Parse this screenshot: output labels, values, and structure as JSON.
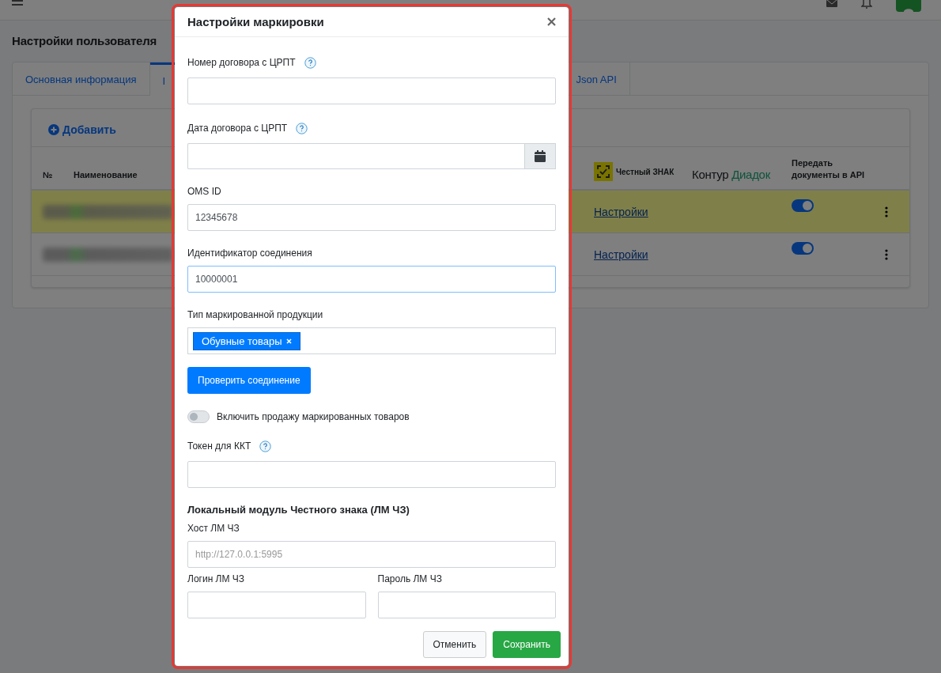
{
  "page": {
    "title": "Настройки пользователя",
    "tabs": [
      {
        "label": "Основная информация",
        "selected": false
      },
      {
        "label": "I",
        "selected": true
      },
      {
        "label": "Json API",
        "selected": false
      }
    ],
    "add_button": "Добавить",
    "table": {
      "columns": {
        "number": "№",
        "name": "Наименование",
        "chz": "Честный ЗНАК",
        "diadok_brand": "Контур",
        "diadok_product": "Диадок",
        "api": "Передать документы в API"
      },
      "rows": [
        {
          "highlighted": true,
          "settings_link": "Настройки",
          "api_on": true
        },
        {
          "highlighted": false,
          "settings_link": "Настройки",
          "api_on": true
        }
      ]
    }
  },
  "modal": {
    "title": "Настройки маркировки",
    "items": [
      {
        "kind": "text",
        "label": "Номер договора с ЦРПТ",
        "help": true
      },
      {
        "kind": "date",
        "label": "Дата договора с ЦРПТ",
        "help": true
      },
      {
        "kind": "text",
        "label": "OMS ID",
        "value": "12345678"
      },
      {
        "kind": "text",
        "label": "Идентификатор соединения",
        "value": "10000001",
        "focused": true
      },
      {
        "kind": "tags",
        "label": "Тип маркированной продукции",
        "tags": [
          "Обувные товары"
        ]
      },
      {
        "kind": "button",
        "label": "Проверить соединение"
      },
      {
        "kind": "switch",
        "label": "Включить продажу маркированных товаров",
        "on": false
      },
      {
        "kind": "text",
        "label": "Токен для ККТ",
        "help": true
      },
      {
        "kind": "heading",
        "label": "Локальный модуль Честного знака (ЛМ ЧЗ)"
      },
      {
        "kind": "text",
        "label": "Хост ЛМ ЧЗ",
        "placeholder": "http://127.0.0.1:5995"
      },
      {
        "kind": "pair",
        "fields": [
          {
            "label": "Логин ЛМ ЧЗ"
          },
          {
            "label": "Пароль ЛМ ЧЗ"
          }
        ]
      }
    ],
    "buttons": [
      {
        "kind": "secondary",
        "label": "Отменить"
      },
      {
        "kind": "primary",
        "label": "Сохранить"
      }
    ]
  }
}
